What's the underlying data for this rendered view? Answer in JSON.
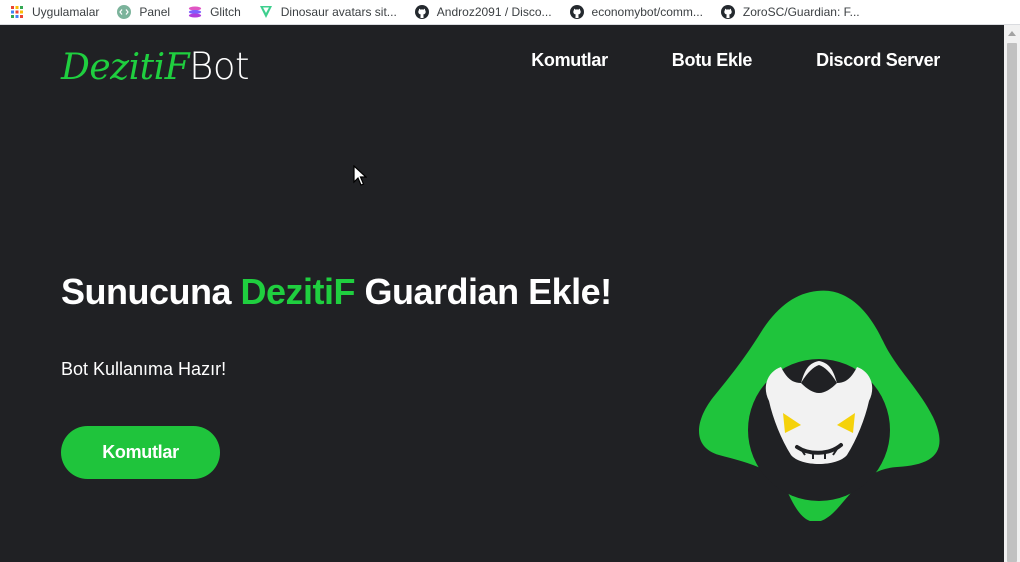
{
  "bookmarks": [
    {
      "label": "Uygulamalar",
      "icon": "apps-grid-icon"
    },
    {
      "label": "Panel",
      "icon": "panel-icon"
    },
    {
      "label": "Glitch",
      "icon": "glitch-icon"
    },
    {
      "label": "Dinosaur avatars sit...",
      "icon": "dinosaur-icon"
    },
    {
      "label": "Androz2091 / Disco...",
      "icon": "github-icon"
    },
    {
      "label": "economybot/comm...",
      "icon": "github-icon"
    },
    {
      "label": "ZoroSC/Guardian: F...",
      "icon": "github-icon"
    }
  ],
  "logo": {
    "part1": "DezitiF",
    "part2": "Bot"
  },
  "nav": {
    "commands": "Komutlar",
    "add_bot": "Botu Ekle",
    "discord": "Discord Server"
  },
  "hero": {
    "title_before": "Sunucuna ",
    "title_accent": "DezitiF",
    "title_after": " Guardian Ekle!",
    "subtitle": "Bot Kullanıma Hazır!",
    "button_label": "Komutlar"
  },
  "colors": {
    "background": "#202124",
    "accent": "#1fcf3f",
    "text": "#ffffff"
  }
}
